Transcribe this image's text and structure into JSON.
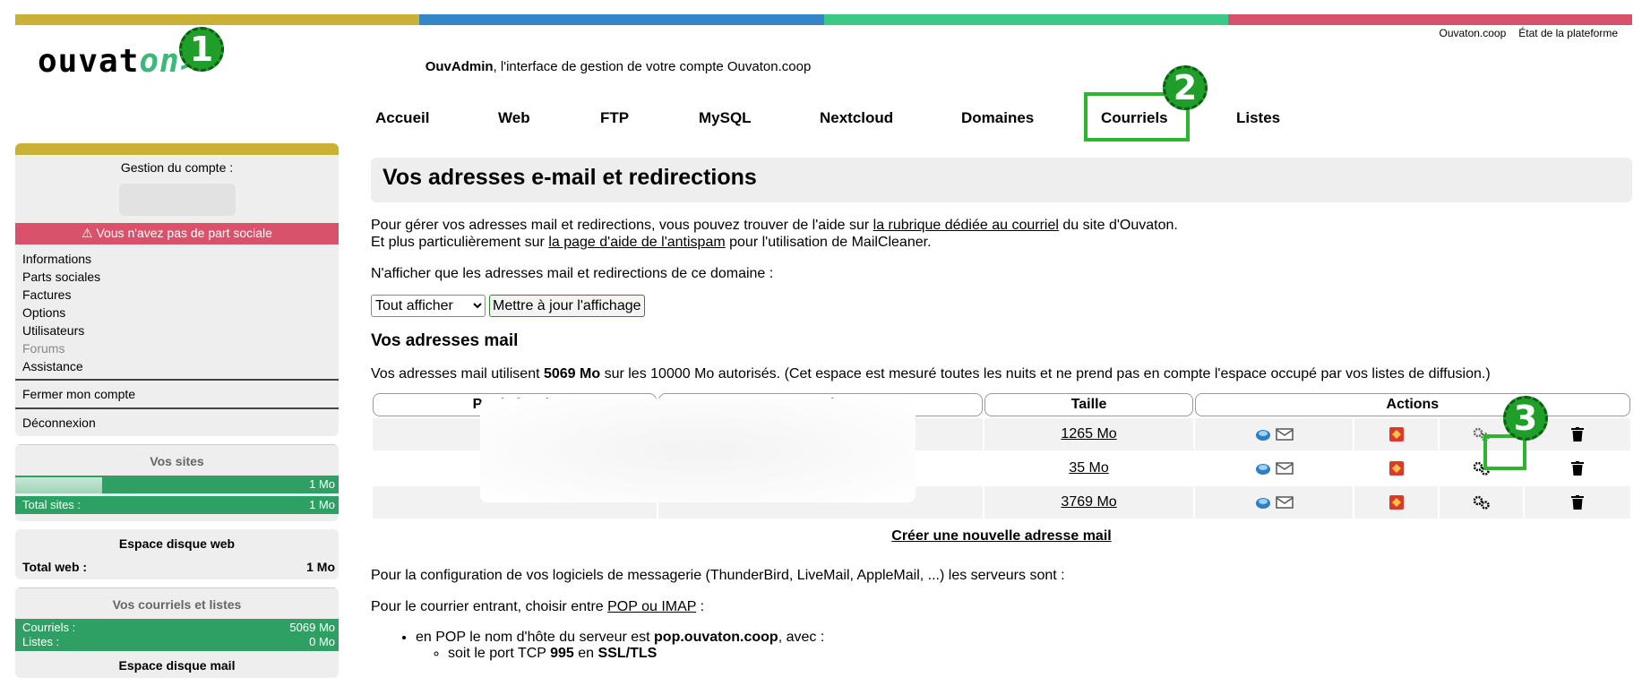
{
  "topbar_colors": [
    "#c9b136",
    "#3586c9",
    "#3cc887",
    "#d9526b"
  ],
  "top_links": [
    "Ouvaton.coop",
    "État de la plateforme"
  ],
  "logo": {
    "part1": "ouvat",
    "part2": "on",
    "arrow": ">"
  },
  "badges": [
    "1",
    "2",
    "3"
  ],
  "tagline": {
    "brand": "OuvAdmin",
    "rest": ", l'interface de gestion de votre compte Ouvaton.coop"
  },
  "nav": [
    "Accueil",
    "Web",
    "FTP",
    "MySQL",
    "Nextcloud",
    "Domaines",
    "Courriels",
    "Listes"
  ],
  "sidebar": {
    "account_title": "Gestion du compte :",
    "alert": "Vous n'avez pas de part sociale",
    "menu": [
      "Informations",
      "Parts sociales",
      "Factures",
      "Options",
      "Utilisateurs",
      "Forums",
      "Assistance"
    ],
    "close_account": "Fermer mon compte",
    "logout": "Déconnexion",
    "sites_title": "Vos sites",
    "sites_bar_value": "1 Mo",
    "sites_bar_fraction": 0.27,
    "sites_total_label": "Total sites :",
    "sites_total_value": "1 Mo",
    "web_disk_title": "Espace disque web",
    "web_total_label": "Total web :",
    "web_total_value": "1 Mo",
    "mail_title": "Vos courriels et listes",
    "mail_label": "Courriels :",
    "mail_value": "5069 Mo",
    "lists_label": "Listes :",
    "lists_value": "0 Mo",
    "mail_disk_title": "Espace disque mail"
  },
  "main": {
    "title": "Vos adresses e-mail et redirections",
    "intro1_pre": "Pour gérer vos adresses mail et redirections, vous pouvez trouver de l'aide sur ",
    "intro1_link": "la rubrique dédiée au courriel",
    "intro1_post": " du site d'Ouvaton.",
    "intro2_pre": "Et plus particulièrement sur ",
    "intro2_link": "la page d'aide de l'antispam",
    "intro2_post": " pour l'utilisation de MailCleaner.",
    "filter_label": "N'afficher que les adresses mail et redirections de ce domaine :",
    "filter_selected": "Tout afficher",
    "update_button": "Mettre à jour l'affichage",
    "section_title": "Vos adresses mail",
    "usage_pre": "Vos adresses mail utilisent ",
    "usage_value": "5069 Mo",
    "usage_post": " sur les 10000 Mo autorisés. (Cet espace est mesuré toutes les nuits et ne prend pas en compte l'espace occupé par vos listes de diffusion.)",
    "columns": [
      "Partie locale",
      "Domaine",
      "Taille",
      "Actions"
    ],
    "rows": [
      {
        "size": "1265 Mo"
      },
      {
        "size": "35 Mo"
      },
      {
        "size": "3769 Mo"
      }
    ],
    "create_link": "Créer une nouvelle adresse mail",
    "config_text": "Pour la configuration de vos logiciels de messagerie (ThunderBird, LiveMail, AppleMail, ...) les serveurs sont :",
    "incoming_pre": "Pour le courrier entrant, choisir entre ",
    "incoming_link": "POP ou IMAP",
    "incoming_post": " :",
    "pop_pre": "en POP le nom d'hôte du serveur est ",
    "pop_host": "pop.ouvaton.coop",
    "pop_post": ", avec :",
    "port_pre": "soit le port TCP ",
    "port_value": "995",
    "port_mid": " en ",
    "port_proto": "SSL/TLS"
  }
}
